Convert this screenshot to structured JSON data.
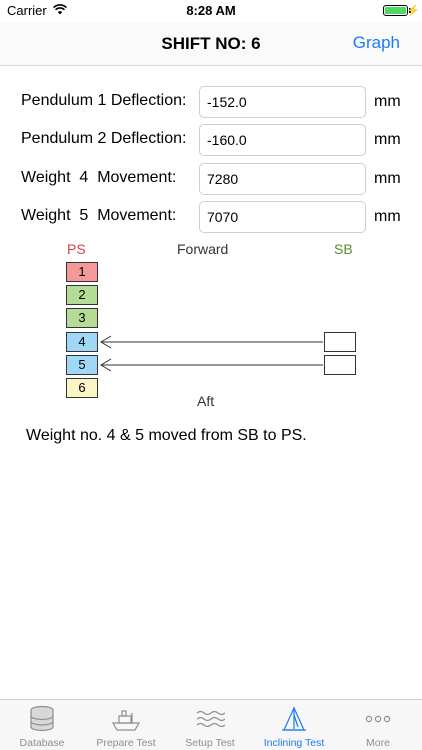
{
  "status_bar": {
    "carrier": "Carrier",
    "time": "8:28 AM",
    "battery_level": 1.0
  },
  "nav": {
    "title": "SHIFT NO: 6",
    "graph_label": "Graph"
  },
  "form": {
    "rows": [
      {
        "label": "Pendulum 1 Deflection:",
        "value": "-152.0",
        "unit": "mm"
      },
      {
        "label": "Pendulum 2 Deflection:",
        "value": "-160.0",
        "unit": "mm"
      },
      {
        "label": "Weight  4  Movement:",
        "value": "7280",
        "unit": "mm"
      },
      {
        "label": "Weight  5  Movement:",
        "value": "7070",
        "unit": "mm"
      }
    ]
  },
  "diagram": {
    "ps_label": "PS",
    "forward_label": "Forward",
    "sb_label": "SB",
    "aft_label": "Aft",
    "slots": [
      {
        "number": "1",
        "color": "#f4999a"
      },
      {
        "number": "2",
        "color": "#b5dc97"
      },
      {
        "number": "3",
        "color": "#b5dc97"
      },
      {
        "number": "4",
        "color": "#9ed8f5"
      },
      {
        "number": "5",
        "color": "#9ed8f5"
      },
      {
        "number": "6",
        "color": "#fbf4c4"
      }
    ],
    "moved_slots": [
      "4",
      "5"
    ]
  },
  "description": "Weight no. 4 & 5 moved from SB to PS.",
  "tabs": [
    {
      "label": "Database",
      "icon": "database-icon",
      "active": false
    },
    {
      "label": "Prepare Test",
      "icon": "ship-icon",
      "active": false
    },
    {
      "label": "Setup Test",
      "icon": "waves-icon",
      "active": false
    },
    {
      "label": "Inclining Test",
      "icon": "inclining-icon",
      "active": true
    },
    {
      "label": "More",
      "icon": "more-icon",
      "active": false
    }
  ],
  "colors": {
    "accent": "#1a7cf5",
    "ps": "#d0463c",
    "sb": "#5b8a32"
  }
}
